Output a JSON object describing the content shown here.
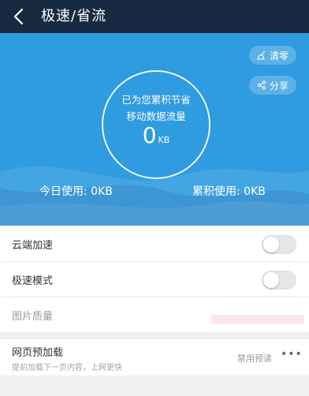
{
  "header": {
    "title": "极速/省流"
  },
  "hero": {
    "clear_label": "清零",
    "share_label": "分享",
    "saved_line1": "已为您累积节省",
    "saved_line2": "移动数据流量",
    "saved_value": "0",
    "saved_unit": "KB",
    "today_usage": "今日使用: 0KB",
    "total_usage": "累积使用: 0KB"
  },
  "settings": {
    "cloud_accel": {
      "label": "云端加速",
      "enabled": false
    },
    "fast_mode": {
      "label": "极速模式",
      "enabled": false
    },
    "image_quality": {
      "label": "图片质量"
    },
    "preload": {
      "title": "网页预加载",
      "subtitle": "提前加载下一页内容，上网更快",
      "value": "禁用预读",
      "more": "•••"
    }
  },
  "colors": {
    "topbar": "#182a42",
    "hero": "#2f9be0",
    "toggle_off": "#e6e6e6"
  }
}
